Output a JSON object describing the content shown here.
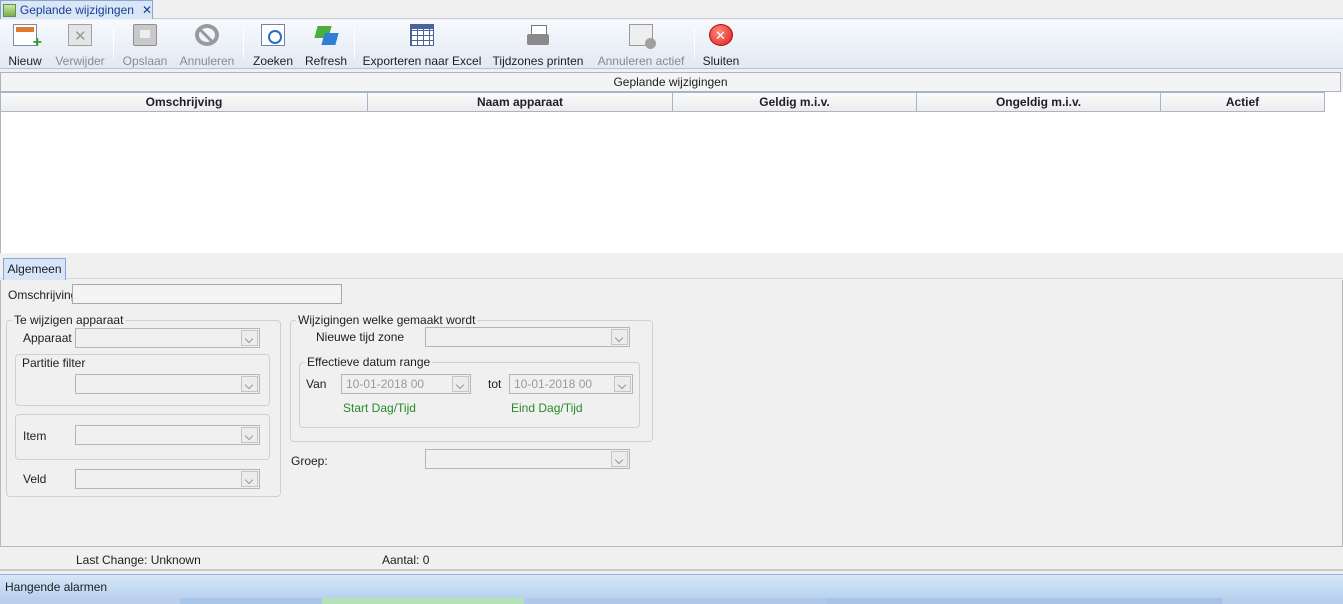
{
  "document_tab": {
    "title": "Geplande wijzigingen",
    "close": "✕"
  },
  "toolbar": {
    "nieuw": "Nieuw",
    "verwijder": "Verwijder",
    "opslaan": "Opslaan",
    "annuleren": "Annuleren",
    "zoeken": "Zoeken",
    "refresh": "Refresh",
    "exporteren": "Exporteren naar Excel",
    "tijdzones_printen": "Tijdzones printen",
    "annuleren_actief": "Annuleren actief",
    "sluiten": "Sluiten"
  },
  "grid": {
    "caption": "Geplande wijzigingen",
    "columns": [
      "Omschrijving",
      "Naam apparaat",
      "Geldig m.i.v.",
      "Ongeldig m.i.v.",
      "Actief"
    ]
  },
  "detail": {
    "tab": "Algemeen",
    "omschrijving_label": "Omschrijving",
    "omschrijving_value": "",
    "te_wijzigen": {
      "title": "Te wijzigen apparaat",
      "apparaat_label": "Apparaat",
      "partitie_filter_label": "Partitie filter",
      "item_label": "Item",
      "veld_label": "Veld"
    },
    "wijzigingen": {
      "title": "Wijzigingen welke gemaakt wordt",
      "nieuwe_tijd_zone_label": "Nieuwe tijd zone",
      "effectieve_title": "Effectieve datum range",
      "van_label": "Van",
      "van_value": "10-01-2018 00",
      "tot_label": "tot",
      "tot_value": "10-01-2018 00",
      "start_label": "Start Dag/Tijd",
      "eind_label": "Eind Dag/Tijd"
    },
    "groep_label": "Groep:"
  },
  "status": {
    "last_change": "Last Change: Unknown",
    "aantal": "Aantal: 0"
  },
  "alarm_bar": {
    "label": "Hangende alarmen"
  },
  "colors": {
    "accent": "#1a3f8f",
    "green_text": "#2a8a2a",
    "alarm_bar": "#b9d2ef"
  }
}
